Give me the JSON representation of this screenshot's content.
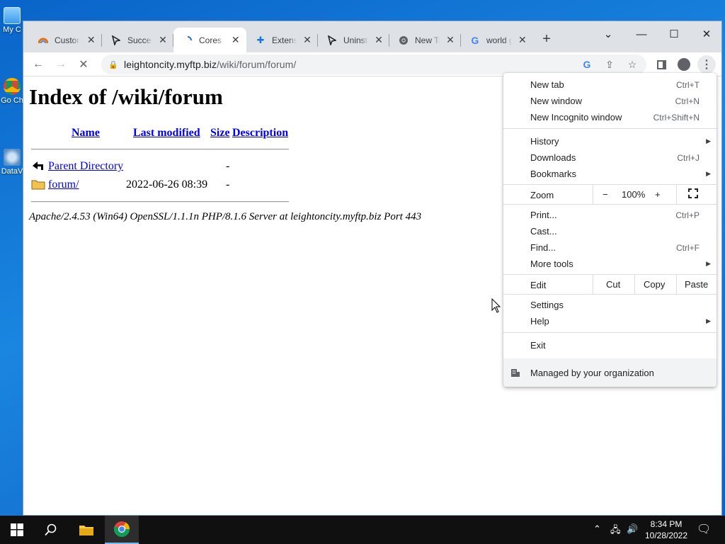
{
  "desktop": {
    "icons": [
      {
        "label": "My C",
        "name": "this-pc"
      },
      {
        "label": "Go Ch",
        "name": "google-chrome-shortcut"
      },
      {
        "label": "DataV",
        "name": "datav-shortcut"
      }
    ]
  },
  "browser": {
    "tabs": [
      {
        "title": "Custom",
        "icon": "colorful-icon",
        "active": false
      },
      {
        "title": "Success",
        "icon": "cursor-arrow-icon",
        "active": false
      },
      {
        "title": "Cores F",
        "icon": "loading-spinner-icon",
        "active": true
      },
      {
        "title": "Extensions",
        "icon": "puzzle-icon",
        "active": false
      },
      {
        "title": "Uninstall",
        "icon": "cursor-arrow-icon",
        "active": false
      },
      {
        "title": "New Tab",
        "icon": "chrome-icon",
        "active": false
      },
      {
        "title": "world g",
        "icon": "google-icon",
        "active": false
      }
    ],
    "new_tab_glyph": "+",
    "url_domain": "leightoncity.myftp.biz",
    "url_path": "/wiki/forum/forum/"
  },
  "page": {
    "title": "Index of /wiki/forum",
    "columns": [
      "Name",
      "Last modified",
      "Size",
      "Description"
    ],
    "rows": [
      {
        "name": "Parent Directory",
        "modified": "",
        "size": "-",
        "icon": "back-arrow-icon"
      },
      {
        "name": "forum/",
        "modified": "2022-06-26 08:39",
        "size": "-",
        "icon": "folder-icon"
      }
    ],
    "address": "Apache/2.4.53 (Win64) OpenSSL/1.1.1n PHP/8.1.6 Server at leightoncity.myftp.biz Port 443"
  },
  "menu": {
    "new_tab": {
      "label": "New tab",
      "shortcut": "Ctrl+T"
    },
    "new_window": {
      "label": "New window",
      "shortcut": "Ctrl+N"
    },
    "incognito": {
      "label": "New Incognito window",
      "shortcut": "Ctrl+Shift+N"
    },
    "history": {
      "label": "History"
    },
    "downloads": {
      "label": "Downloads",
      "shortcut": "Ctrl+J"
    },
    "bookmarks": {
      "label": "Bookmarks"
    },
    "zoom": {
      "label": "Zoom",
      "minus": "−",
      "value": "100%",
      "plus": "+"
    },
    "print": {
      "label": "Print...",
      "shortcut": "Ctrl+P"
    },
    "cast": {
      "label": "Cast..."
    },
    "find": {
      "label": "Find...",
      "shortcut": "Ctrl+F"
    },
    "more_tools": {
      "label": "More tools"
    },
    "edit": {
      "label": "Edit",
      "cut": "Cut",
      "copy": "Copy",
      "paste": "Paste"
    },
    "settings": {
      "label": "Settings"
    },
    "help": {
      "label": "Help"
    },
    "exit": {
      "label": "Exit"
    },
    "managed": {
      "label": "Managed by your organization"
    }
  },
  "taskbar": {
    "time": "8:34 PM",
    "date": "10/28/2022"
  }
}
